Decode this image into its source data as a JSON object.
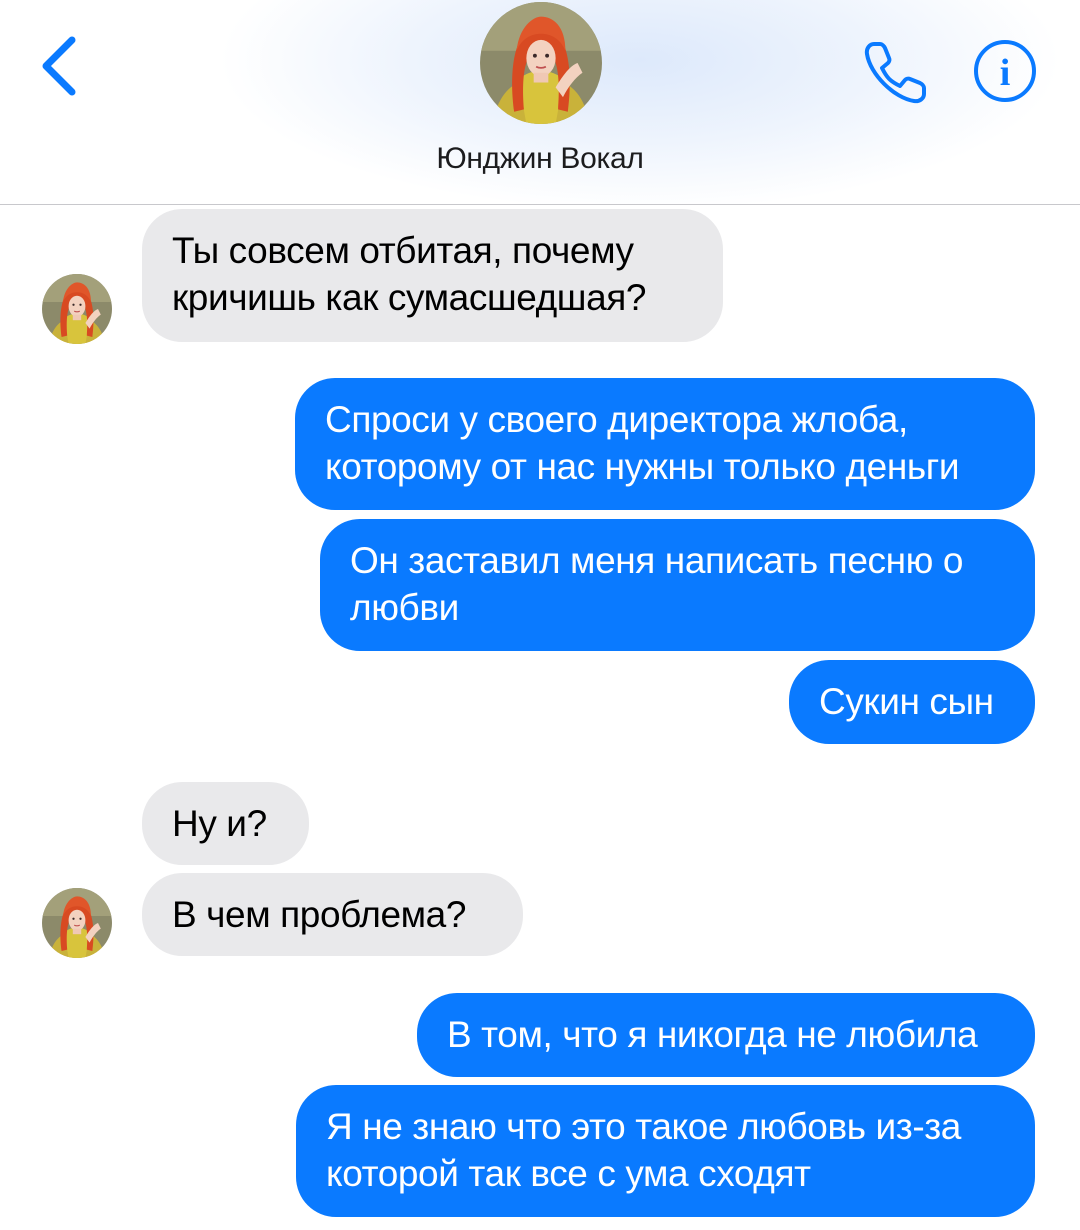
{
  "header": {
    "contact_name": "Юнджин Вокал",
    "back_icon": "chevron-left-icon",
    "call_icon": "phone-icon",
    "info_icon": "info-icon",
    "info_glyph": "i",
    "accent_color": "#0a7aff"
  },
  "messages": [
    {
      "side": "incoming",
      "text": "Ты совсем отбитая, почему кричишь как сумасшедшая?"
    },
    {
      "side": "outgoing",
      "text": "Спроси у своего директора жлоба, которому от нас нужны только деньги"
    },
    {
      "side": "outgoing",
      "text": "Он заставил меня написать песню о любви"
    },
    {
      "side": "outgoing",
      "text": "Сукин сын"
    },
    {
      "side": "incoming",
      "text": "Ну и?"
    },
    {
      "side": "incoming",
      "text": "В чем проблема?"
    },
    {
      "side": "outgoing",
      "text": "В том, что я никогда не любила"
    },
    {
      "side": "outgoing",
      "text": "Я не знаю что это такое любовь из-за которой так все с ума сходят"
    }
  ],
  "colors": {
    "incoming_bubble": "#e9e9eb",
    "outgoing_bubble": "#0a7aff"
  }
}
